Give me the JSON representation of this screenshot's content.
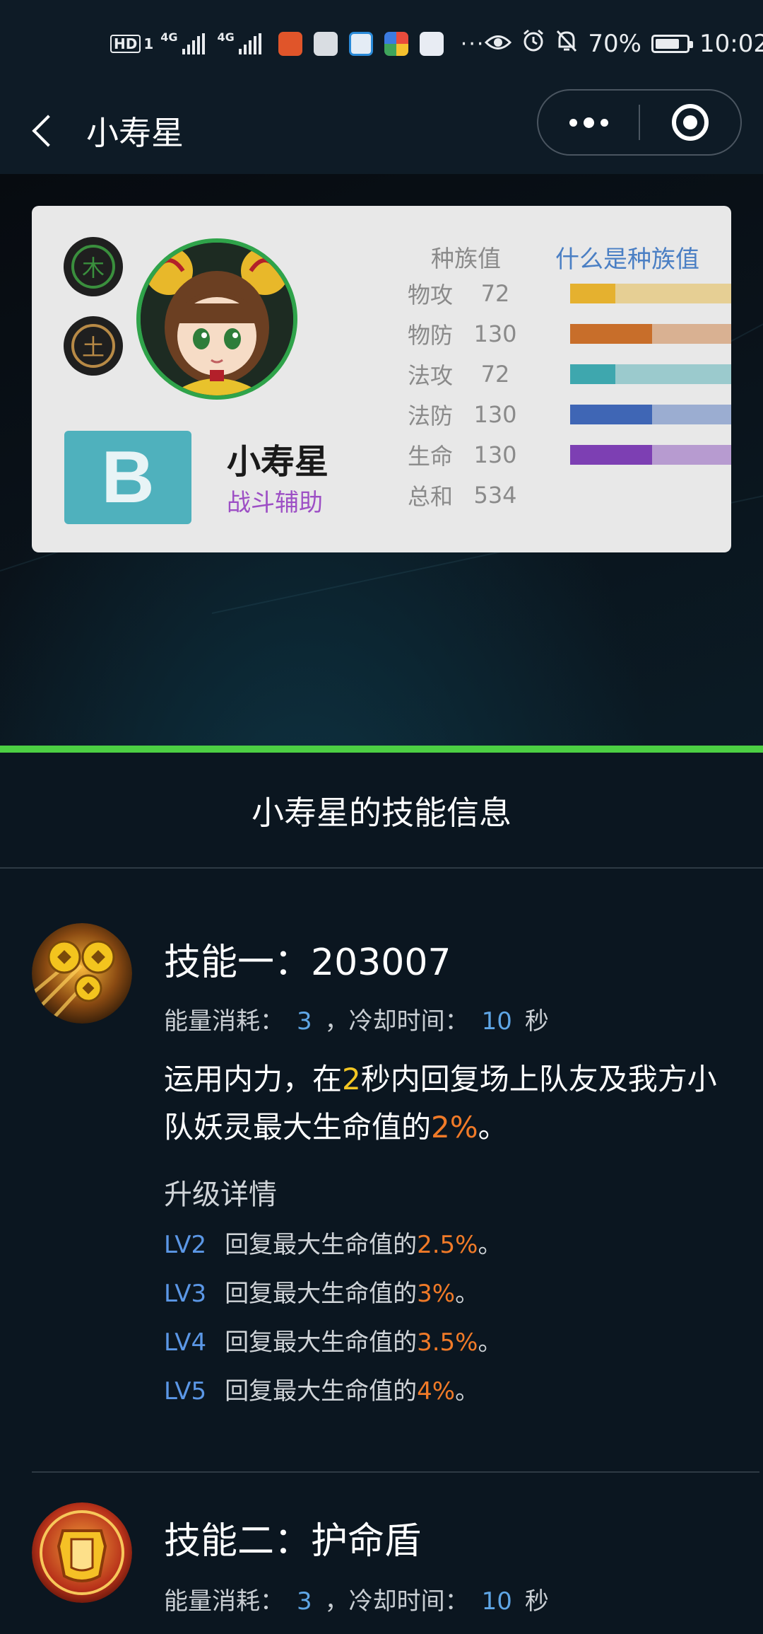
{
  "status_bar": {
    "hd_label": "HD",
    "sim_label": "1",
    "net1": "4G",
    "net2": "4G",
    "more": "···",
    "battery_pct": "70%",
    "time": "10:02"
  },
  "nav": {
    "title": "小寿星"
  },
  "pet": {
    "elements": [
      "木",
      "土"
    ],
    "grade": "B",
    "name": "小寿星",
    "role": "战斗辅助",
    "race_header": "种族值",
    "race_link": "什么是种族值",
    "stats": [
      {
        "label": "物攻",
        "value": "72",
        "ratio": 0.28,
        "color": "#e5b12f"
      },
      {
        "label": "物防",
        "value": "130",
        "ratio": 0.51,
        "color": "#c86e2a"
      },
      {
        "label": "法攻",
        "value": "72",
        "ratio": 0.28,
        "color": "#3ea7ae"
      },
      {
        "label": "法防",
        "value": "130",
        "ratio": 0.51,
        "color": "#3f66b5"
      },
      {
        "label": "生命",
        "value": "130",
        "ratio": 0.51,
        "color": "#7d3fb3"
      }
    ],
    "total_label": "总和",
    "total_value": "534"
  },
  "skills_section": {
    "title": "小寿星的技能信息",
    "skills": [
      {
        "name": "技能一：203007",
        "energy_label": "能量消耗：",
        "energy": "3",
        "cooldown_label": "，冷却时间：",
        "cooldown": "10",
        "cooldown_unit": "秒",
        "desc_parts": {
          "p1": "运用内力，在",
          "hl1": "2",
          "p2": "秒内回复场上队友及我方小队妖灵最大生命值的",
          "hl2": "2%",
          "p3": "。"
        },
        "upgrade_title": "升级详情",
        "upgrades": [
          {
            "lv": "LV2",
            "text": "回复最大生命值的",
            "value": "2.5%",
            "end": "。"
          },
          {
            "lv": "LV3",
            "text": "回复最大生命值的",
            "value": "3%",
            "end": "。"
          },
          {
            "lv": "LV4",
            "text": "回复最大生命值的",
            "value": "3.5%",
            "end": "。"
          },
          {
            "lv": "LV5",
            "text": "回复最大生命值的",
            "value": "4%",
            "end": "。"
          }
        ]
      },
      {
        "name": "技能二：护命盾",
        "energy_label": "能量消耗：",
        "energy": "3",
        "cooldown_label": "，冷却时间：",
        "cooldown": "10",
        "cooldown_unit": "秒"
      }
    ]
  }
}
